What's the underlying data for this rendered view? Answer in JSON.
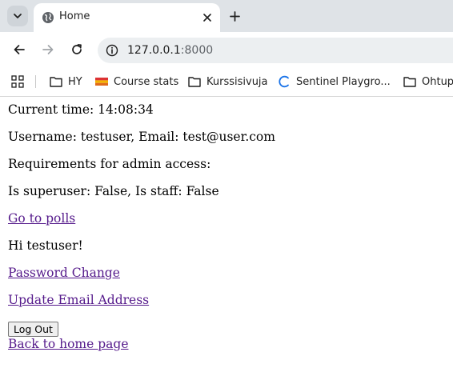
{
  "browser": {
    "tab": {
      "title": "Home"
    },
    "address": {
      "host": "127.0.0.1",
      "port": ":8000"
    },
    "bookmarks": [
      {
        "label": "HY",
        "icon": "folder-icon"
      },
      {
        "label": "Course stats",
        "icon": "course-stats-favicon"
      },
      {
        "label": "Kurssisivuja",
        "icon": "folder-icon"
      },
      {
        "label": "Sentinel Playgro...",
        "icon": "loading-spinner-icon"
      },
      {
        "label": "Ohtup",
        "icon": "folder-icon"
      }
    ]
  },
  "page": {
    "current_time": "Current time: 14:08:34",
    "user_info": "Username: testuser, Email: test@user.com",
    "requirements": "Requirements for admin access:",
    "admin_flags": "Is superuser: False, Is staff: False",
    "polls_link": "Go to polls",
    "greeting": "Hi testuser!",
    "password_change_link": "Password Change",
    "update_email_link": "Update Email Address",
    "logout_button": "Log Out",
    "home_link": "Back to home page"
  },
  "colors": {
    "tabstrip_bg": "#dfe3e7",
    "omnibox_bg": "#eceff1",
    "visited_link": "#551a8b"
  }
}
